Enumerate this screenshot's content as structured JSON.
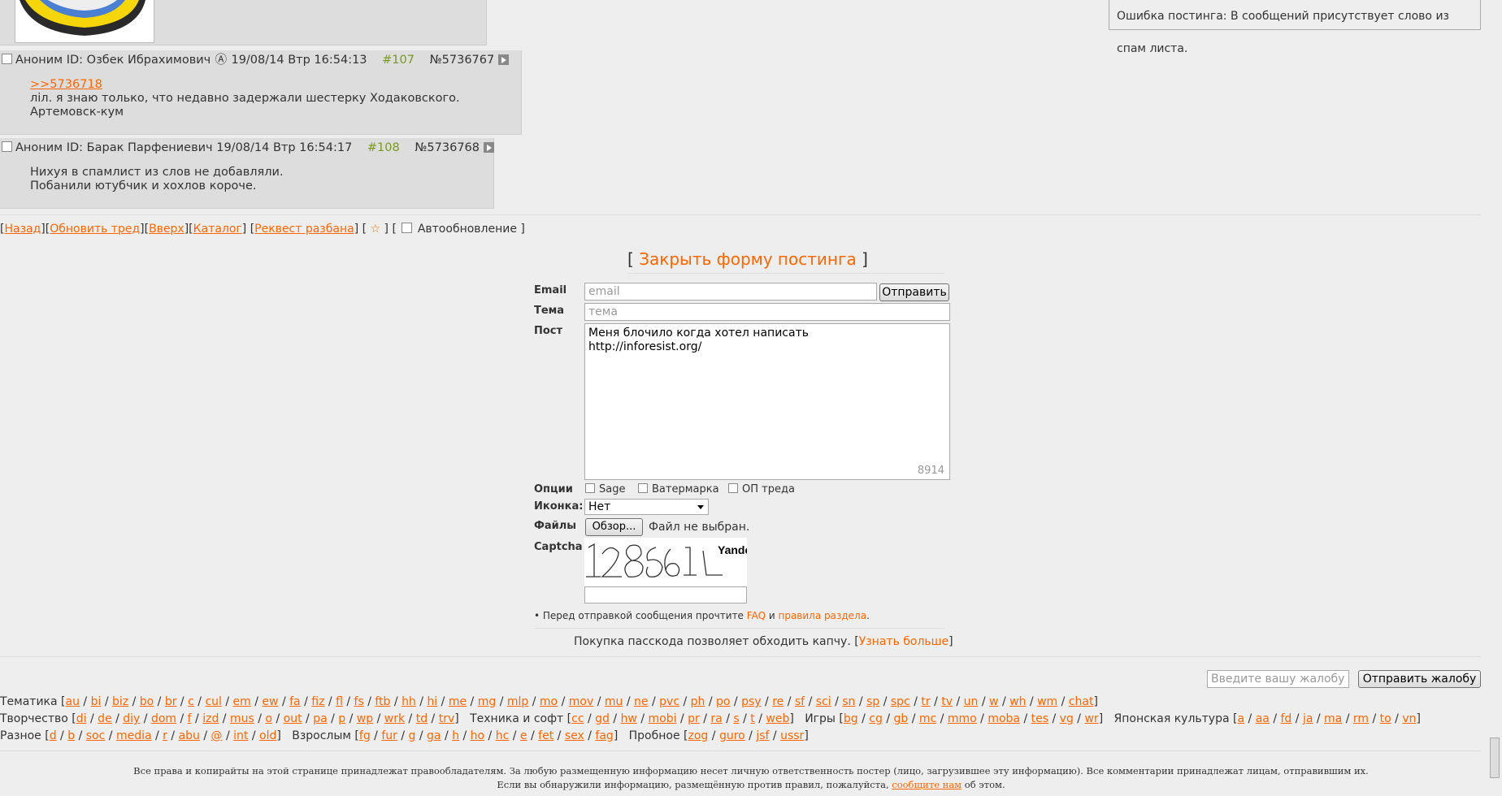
{
  "error_popup": {
    "text": "Ошибка постинга: В сообщений присутствует слово из спам листа."
  },
  "posts": [
    {
      "author": "Аноним ID: Озбек Ибрахимович",
      "date": "19/08/14 Втр 16:54:13",
      "index": "#107",
      "number": "№5736767",
      "reply_link": ">>5736718",
      "lines": [
        "ліл. я знаю только, что недавно задержали шестерку Ходаковского.",
        "Артемовск-кум"
      ]
    },
    {
      "author": "Аноним ID: Барак Парфениевич",
      "date": "19/08/14 Втр 16:54:17",
      "index": "#108",
      "number": "№5736768",
      "lines": [
        "Нихуя в спамлист из слов не добавляли.",
        "Побанили ютубчик и хохлов короче."
      ]
    }
  ],
  "thread_nav": {
    "back": "Назад",
    "refresh": "Обновить тред",
    "up": "Вверх",
    "catalog": "Каталог",
    "unban": "Реквест разбана",
    "star": "☆",
    "autoupdate": "Автообновление"
  },
  "form": {
    "close": "Закрыть форму постинга",
    "email_label": "Email",
    "email_placeholder": "email",
    "submit": "Отправить",
    "subject_label": "Тема",
    "subject_placeholder": "тема",
    "post_label": "Пост",
    "post_lines": [
      "Меня блочило когда хотел написать",
      "http://inforesist.org/"
    ],
    "counter": "8914",
    "options_label": "Опции",
    "opt_sage": "Sage",
    "opt_watermark": "Ватермарка",
    "opt_op": "ОП треда",
    "icon_label": "Иконка:",
    "icon_value": "Нет",
    "files_label": "Файлы",
    "browse": "Обзор...",
    "no_file": "Файл не выбран.",
    "captcha_label": "Captcha",
    "captcha_brand": "Yandex",
    "rules_prefix": "• Перед отправкой сообщения прочтите",
    "faq": "FAQ",
    "and": "и",
    "rules": "правила раздела",
    "pass_text": "Покупка пасскода позволяет обходить капчу.",
    "pass_link": "Узнать больше"
  },
  "complaint": {
    "placeholder": "Введите вашу жалобу",
    "button": "Отправить жалобу"
  },
  "footer_boards": {
    "line1": [
      {
        "title": "Тематика",
        "boards": [
          "au",
          "bi",
          "biz",
          "bo",
          "br",
          "c",
          "cul",
          "em",
          "ew",
          "fa",
          "fiz",
          "fl",
          "fs",
          "ftb",
          "hh",
          "hi",
          "me",
          "mg",
          "mlp",
          "mo",
          "mov",
          "mu",
          "ne",
          "pvc",
          "ph",
          "po",
          "psy",
          "re",
          "sf",
          "sci",
          "sn",
          "sp",
          "spc",
          "tr",
          "tv",
          "un",
          "w",
          "wh",
          "wm",
          "chat"
        ]
      }
    ],
    "line2": [
      {
        "title": "Творчество",
        "boards": [
          "di",
          "de",
          "diy",
          "dom",
          "f",
          "izd",
          "mus",
          "o",
          "out",
          "pa",
          "p",
          "wp",
          "wrk",
          "td",
          "trv"
        ]
      },
      {
        "title": "Техника и софт",
        "boards": [
          "cc",
          "gd",
          "hw",
          "mobi",
          "pr",
          "ra",
          "s",
          "t",
          "web"
        ]
      },
      {
        "title": "Игры",
        "boards": [
          "bg",
          "cg",
          "gb",
          "mc",
          "mmo",
          "moba",
          "tes",
          "vg",
          "wr"
        ]
      },
      {
        "title": "Японская культура",
        "boards": [
          "a",
          "aa",
          "fd",
          "ja",
          "ma",
          "rm",
          "to",
          "vn"
        ]
      }
    ],
    "line3": [
      {
        "title": "Разное",
        "boards": [
          "d",
          "b",
          "soc",
          "media",
          "r",
          "abu",
          "@",
          "int",
          "old"
        ]
      },
      {
        "title": "Взрослым",
        "boards": [
          "fg",
          "fur",
          "g",
          "ga",
          "h",
          "ho",
          "hc",
          "e",
          "fet",
          "sex",
          "fag"
        ]
      },
      {
        "title": "Пробное",
        "boards": [
          "zog",
          "guro",
          "jsf",
          "ussr"
        ]
      }
    ]
  },
  "copyright": {
    "line1": "Все права и копирайты на этой странице принадлежат правообладателям. За любую размещенную информацию несет личную ответственность постер (лицо, загрузившее эту информацию). Все комментарии принадлежат лицам, отправившим их.",
    "line2_prefix": "Если вы обнаружили информацию, размещённую против правил, пожалуйста,",
    "line2_link": "сообщите нам",
    "line2_suffix": "об этом."
  },
  "colors": {
    "link": "#ff6600",
    "post_num": "#789922",
    "post_bg": "#dddddd",
    "page_bg": "#eeeeee"
  }
}
